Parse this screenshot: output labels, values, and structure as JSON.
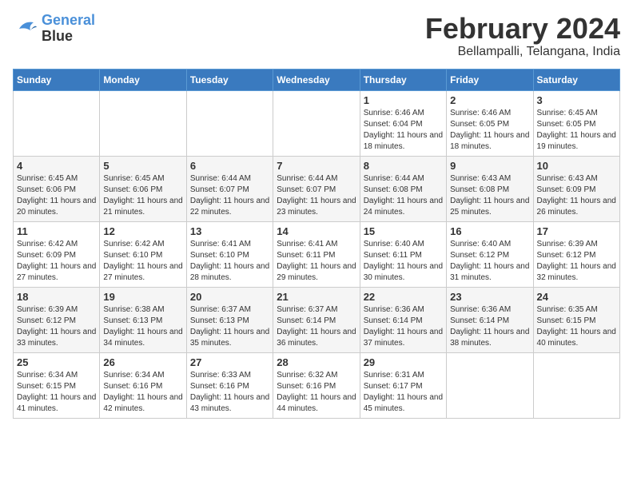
{
  "logo": {
    "line1": "General",
    "line2": "Blue"
  },
  "title": "February 2024",
  "subtitle": "Bellampalli, Telangana, India",
  "headers": [
    "Sunday",
    "Monday",
    "Tuesday",
    "Wednesday",
    "Thursday",
    "Friday",
    "Saturday"
  ],
  "weeks": [
    [
      {
        "day": "",
        "info": ""
      },
      {
        "day": "",
        "info": ""
      },
      {
        "day": "",
        "info": ""
      },
      {
        "day": "",
        "info": ""
      },
      {
        "day": "1",
        "info": "Sunrise: 6:46 AM\nSunset: 6:04 PM\nDaylight: 11 hours and 18 minutes."
      },
      {
        "day": "2",
        "info": "Sunrise: 6:46 AM\nSunset: 6:05 PM\nDaylight: 11 hours and 18 minutes."
      },
      {
        "day": "3",
        "info": "Sunrise: 6:45 AM\nSunset: 6:05 PM\nDaylight: 11 hours and 19 minutes."
      }
    ],
    [
      {
        "day": "4",
        "info": "Sunrise: 6:45 AM\nSunset: 6:06 PM\nDaylight: 11 hours and 20 minutes."
      },
      {
        "day": "5",
        "info": "Sunrise: 6:45 AM\nSunset: 6:06 PM\nDaylight: 11 hours and 21 minutes."
      },
      {
        "day": "6",
        "info": "Sunrise: 6:44 AM\nSunset: 6:07 PM\nDaylight: 11 hours and 22 minutes."
      },
      {
        "day": "7",
        "info": "Sunrise: 6:44 AM\nSunset: 6:07 PM\nDaylight: 11 hours and 23 minutes."
      },
      {
        "day": "8",
        "info": "Sunrise: 6:44 AM\nSunset: 6:08 PM\nDaylight: 11 hours and 24 minutes."
      },
      {
        "day": "9",
        "info": "Sunrise: 6:43 AM\nSunset: 6:08 PM\nDaylight: 11 hours and 25 minutes."
      },
      {
        "day": "10",
        "info": "Sunrise: 6:43 AM\nSunset: 6:09 PM\nDaylight: 11 hours and 26 minutes."
      }
    ],
    [
      {
        "day": "11",
        "info": "Sunrise: 6:42 AM\nSunset: 6:09 PM\nDaylight: 11 hours and 27 minutes."
      },
      {
        "day": "12",
        "info": "Sunrise: 6:42 AM\nSunset: 6:10 PM\nDaylight: 11 hours and 27 minutes."
      },
      {
        "day": "13",
        "info": "Sunrise: 6:41 AM\nSunset: 6:10 PM\nDaylight: 11 hours and 28 minutes."
      },
      {
        "day": "14",
        "info": "Sunrise: 6:41 AM\nSunset: 6:11 PM\nDaylight: 11 hours and 29 minutes."
      },
      {
        "day": "15",
        "info": "Sunrise: 6:40 AM\nSunset: 6:11 PM\nDaylight: 11 hours and 30 minutes."
      },
      {
        "day": "16",
        "info": "Sunrise: 6:40 AM\nSunset: 6:12 PM\nDaylight: 11 hours and 31 minutes."
      },
      {
        "day": "17",
        "info": "Sunrise: 6:39 AM\nSunset: 6:12 PM\nDaylight: 11 hours and 32 minutes."
      }
    ],
    [
      {
        "day": "18",
        "info": "Sunrise: 6:39 AM\nSunset: 6:12 PM\nDaylight: 11 hours and 33 minutes."
      },
      {
        "day": "19",
        "info": "Sunrise: 6:38 AM\nSunset: 6:13 PM\nDaylight: 11 hours and 34 minutes."
      },
      {
        "day": "20",
        "info": "Sunrise: 6:37 AM\nSunset: 6:13 PM\nDaylight: 11 hours and 35 minutes."
      },
      {
        "day": "21",
        "info": "Sunrise: 6:37 AM\nSunset: 6:14 PM\nDaylight: 11 hours and 36 minutes."
      },
      {
        "day": "22",
        "info": "Sunrise: 6:36 AM\nSunset: 6:14 PM\nDaylight: 11 hours and 37 minutes."
      },
      {
        "day": "23",
        "info": "Sunrise: 6:36 AM\nSunset: 6:14 PM\nDaylight: 11 hours and 38 minutes."
      },
      {
        "day": "24",
        "info": "Sunrise: 6:35 AM\nSunset: 6:15 PM\nDaylight: 11 hours and 40 minutes."
      }
    ],
    [
      {
        "day": "25",
        "info": "Sunrise: 6:34 AM\nSunset: 6:15 PM\nDaylight: 11 hours and 41 minutes."
      },
      {
        "day": "26",
        "info": "Sunrise: 6:34 AM\nSunset: 6:16 PM\nDaylight: 11 hours and 42 minutes."
      },
      {
        "day": "27",
        "info": "Sunrise: 6:33 AM\nSunset: 6:16 PM\nDaylight: 11 hours and 43 minutes."
      },
      {
        "day": "28",
        "info": "Sunrise: 6:32 AM\nSunset: 6:16 PM\nDaylight: 11 hours and 44 minutes."
      },
      {
        "day": "29",
        "info": "Sunrise: 6:31 AM\nSunset: 6:17 PM\nDaylight: 11 hours and 45 minutes."
      },
      {
        "day": "",
        "info": ""
      },
      {
        "day": "",
        "info": ""
      }
    ]
  ]
}
